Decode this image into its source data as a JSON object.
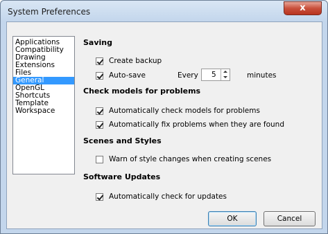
{
  "window": {
    "title": "System Preferences",
    "close_glyph": "x"
  },
  "sidebar": {
    "items": [
      {
        "label": "Applications",
        "selected": false
      },
      {
        "label": "Compatibility",
        "selected": false
      },
      {
        "label": "Drawing",
        "selected": false
      },
      {
        "label": "Extensions",
        "selected": false
      },
      {
        "label": "Files",
        "selected": false
      },
      {
        "label": "General",
        "selected": true
      },
      {
        "label": "OpenGL",
        "selected": false
      },
      {
        "label": "Shortcuts",
        "selected": false
      },
      {
        "label": "Template",
        "selected": false
      },
      {
        "label": "Workspace",
        "selected": false
      }
    ]
  },
  "saving": {
    "heading": "Saving",
    "create_backup": {
      "label": "Create backup",
      "checked": true
    },
    "auto_save": {
      "label": "Auto-save",
      "checked": true
    },
    "every_label": "Every",
    "interval_value": "5",
    "unit_label": "minutes"
  },
  "check_models": {
    "heading": "Check models for problems",
    "auto_check": {
      "label": "Automatically check models for problems",
      "checked": true
    },
    "auto_fix": {
      "label": "Automatically fix problems when they are found",
      "checked": true
    }
  },
  "scenes": {
    "heading": "Scenes and Styles",
    "warn_style": {
      "label": "Warn of style changes when creating scenes",
      "checked": false
    }
  },
  "updates": {
    "heading": "Software Updates",
    "auto_updates": {
      "label": "Automatically check for updates",
      "checked": true
    }
  },
  "buttons": {
    "ok": "OK",
    "cancel": "Cancel"
  }
}
